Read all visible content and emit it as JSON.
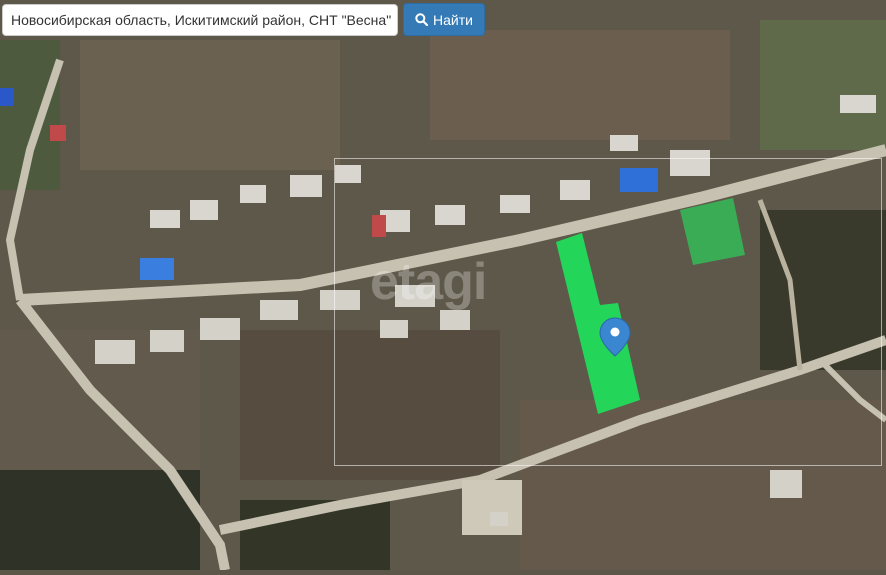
{
  "search": {
    "value": "Новосибирская область, Искитимский район, СНТ \"Весна\"",
    "button_label": "Найти",
    "button_color": "#337ab7"
  },
  "map": {
    "type": "satellite",
    "watermark": "etagi",
    "selected_plot_color": "#1ee05a",
    "neighbor_plot_color": "#2fc85a",
    "marker_color": "#3a86d0",
    "marker_icon": "map-pin-icon"
  }
}
